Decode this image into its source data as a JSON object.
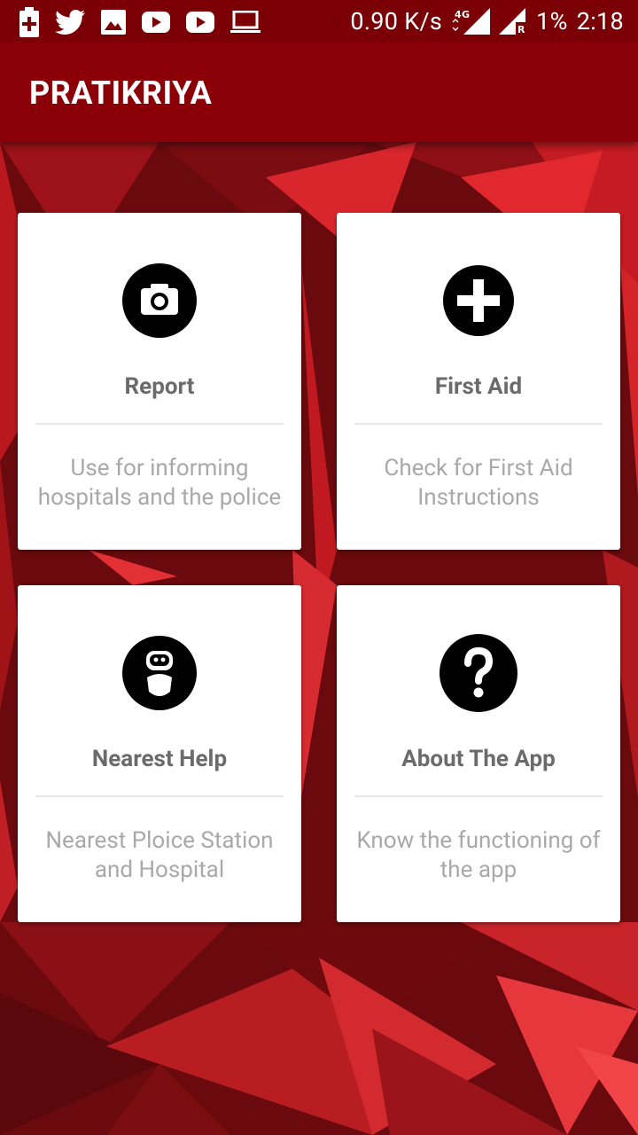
{
  "status_bar": {
    "left_icons": [
      "battery-charging-icon",
      "twitter-icon",
      "gallery-icon",
      "youtube-icon",
      "youtube-icon",
      "laptop-icon"
    ],
    "speed": "0.90 K/s",
    "network_type": "4G",
    "roaming_indicator": "R",
    "battery_percent": "1%",
    "time": "2:18"
  },
  "app_bar": {
    "title": "PRATIKRIYA"
  },
  "cards": {
    "report": {
      "icon": "camera-icon",
      "title": "Report",
      "description": "Use for informing hospitals and the police"
    },
    "first_aid": {
      "icon": "plus-icon",
      "title": "First Aid",
      "description": "Check for First Aid Instructions"
    },
    "nearest_help": {
      "icon": "robot-icon",
      "title": "Nearest Help",
      "description": "Nearest Ploice Station and Hospital"
    },
    "about": {
      "icon": "question-icon",
      "title": "About The App",
      "description": "Know the functioning of the app"
    }
  },
  "colors": {
    "status_bar": "#7a0006",
    "app_bar": "#8a0006",
    "card_background": "#ffffff",
    "card_title": "#6b6b6b",
    "card_description": "#a9a9a9",
    "background_dark": "#6a0a0e",
    "background_bright": "#d8262c"
  }
}
